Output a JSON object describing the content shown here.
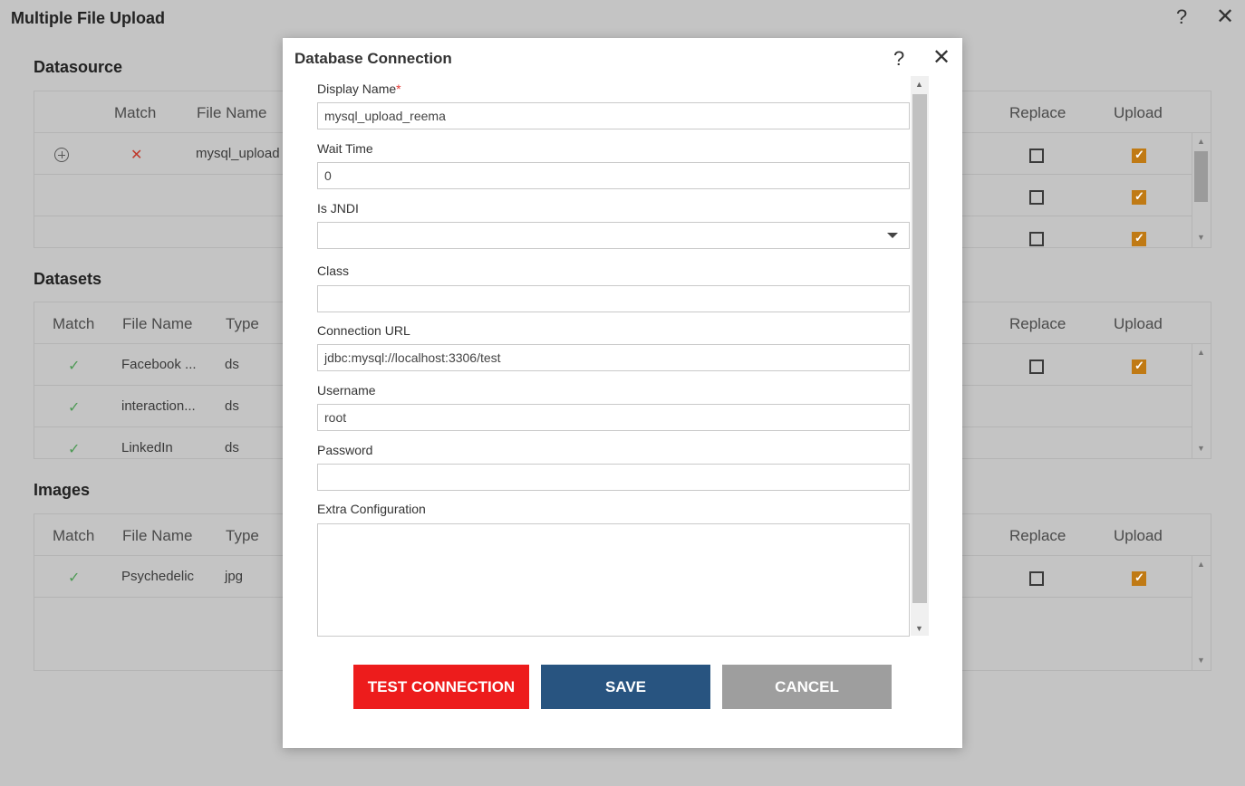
{
  "window": {
    "title": "Multiple File Upload",
    "help": "?",
    "close": "✕"
  },
  "datasource": {
    "title": "Datasource",
    "headers": {
      "match": "Match",
      "file_name": "File Name",
      "replace": "Replace",
      "upload": "Upload"
    },
    "rows": [
      {
        "match": "✕",
        "file_name": "mysql_upload",
        "replace": false,
        "upload": true
      },
      {
        "replace": false,
        "upload": true
      },
      {
        "replace": false,
        "upload": true
      }
    ]
  },
  "datasets": {
    "title": "Datasets",
    "headers": {
      "match": "Match",
      "file_name": "File Name",
      "type": "Type",
      "replace": "Replace",
      "upload": "Upload"
    },
    "rows": [
      {
        "match": "✓",
        "file_name": "Facebook ...",
        "type": "ds",
        "replace": false,
        "upload": true
      },
      {
        "match": "✓",
        "file_name": "interaction...",
        "type": "ds"
      },
      {
        "match": "✓",
        "file_name": "LinkedIn",
        "type": "ds"
      }
    ]
  },
  "images": {
    "title": "Images",
    "headers": {
      "match": "Match",
      "file_name": "File Name",
      "type": "Type",
      "replace": "Replace",
      "upload": "Upload"
    },
    "rows": [
      {
        "match": "✓",
        "file_name": "Psychedelic",
        "type": "jpg",
        "replace": false,
        "upload": true
      }
    ]
  },
  "dialog": {
    "title": "Database Connection",
    "help": "?",
    "close": "✕",
    "fields": {
      "display_name": {
        "label": "Display Name",
        "required_mark": "*",
        "value": "mysql_upload_reema"
      },
      "wait_time": {
        "label": "Wait Time",
        "value": "0"
      },
      "is_jndi": {
        "label": "Is JNDI",
        "value": ""
      },
      "class": {
        "label": "Class",
        "value": ""
      },
      "connection_url": {
        "label": "Connection URL",
        "value": "jdbc:mysql://localhost:3306/test"
      },
      "username": {
        "label": "Username",
        "value": "root"
      },
      "password": {
        "label": "Password",
        "value": ""
      },
      "extra_configuration": {
        "label": "Extra Configuration",
        "value": ""
      }
    },
    "buttons": {
      "test": "TEST CONNECTION",
      "save": "SAVE",
      "cancel": "CANCEL"
    }
  },
  "icons": {
    "add": "plus-circle-icon",
    "scroll_up": "▲",
    "scroll_down": "▼"
  },
  "colors": {
    "accent_checkbox": "#c07a14",
    "test_button": "#ed1c1c",
    "save_button": "#285480",
    "cancel_button": "#9e9e9e",
    "match_ok": "#4e9a55",
    "match_fail": "#c0392b"
  }
}
